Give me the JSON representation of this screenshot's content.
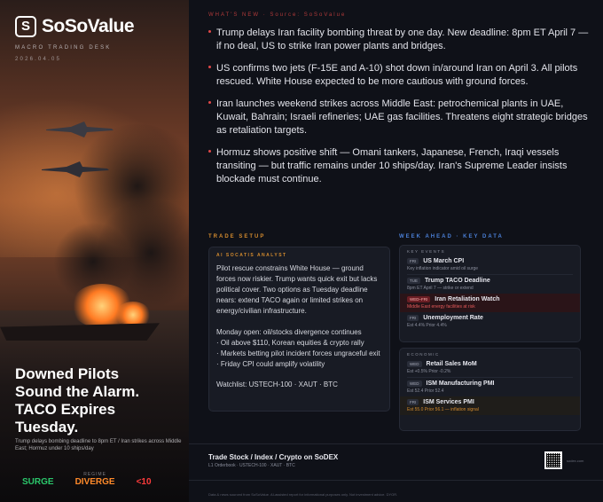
{
  "brand": {
    "name": "SoSoValue",
    "desk": "MACRO TRADING DESK",
    "date": "2026.04.05"
  },
  "hero": {
    "headline": [
      "Downed Pilots",
      "Sound the Alarm.",
      "TACO Expires",
      "Tuesday."
    ],
    "subhead": "Trump delays bombing deadline to 8pm ET / Iran strikes across Middle East; Hormuz under 10 ships/day",
    "tags": [
      {
        "label": "",
        "value": "SURGE",
        "color": "#2bc76b"
      },
      {
        "label": "REGIME",
        "value": "DIVERGE",
        "color": "#ff8a2a"
      },
      {
        "label": "",
        "value": "<10",
        "color": "#ff3b3b"
      }
    ]
  },
  "news": {
    "header": "WHAT'S NEW · Source: SoSoValue",
    "items": [
      "Trump delays Iran facility bombing threat by one day. New deadline: 8pm ET April 7 — if no deal, US to strike Iran power plants and bridges.",
      "US confirms two jets (F-15E and A-10) shot down in/around Iran on April 3. All pilots rescued. White House expected to be more cautious with ground forces.",
      "Iran launches weekend strikes across Middle East: petrochemical plants in UAE, Kuwait, Bahrain; Israeli refineries; UAE gas facilities. Threatens eight strategic bridges as retaliation targets.",
      "Hormuz shows positive shift — Omani tankers, Japanese, French, Iraqi vessels transiting — but traffic remains under 10 ships/day. Iran's Supreme Leader insists blockade must continue."
    ]
  },
  "trade": {
    "header": "TRADE SETUP",
    "card_label": "AI SOCATIS ANALYST",
    "para1": "Pilot rescue constrains White House — ground forces now riskier. Trump wants quick exit but lacks political cover. Two options as Tuesday deadline nears: extend TACO again or limited strikes on energy/civilian infrastructure.",
    "para2_title": "Monday open: oil/stocks divergence continues",
    "bullets": [
      "· Oil above $110, Korean equities & crypto rally",
      "· Markets betting pilot incident forces ungraceful exit",
      "· Friday CPI could amplify volatility"
    ],
    "watchlist": "Watchlist:  USTECH-100 · XAUT · BTC"
  },
  "week": {
    "header": "WEEK AHEAD · KEY DATA",
    "key_label": "KEY EVENTS",
    "key_events": [
      {
        "day": "FRI",
        "title": "US March CPI",
        "sub": "Key inflation indicator amid oil surge",
        "hi": false
      },
      {
        "day": "TUE",
        "title": "Trump TACO Deadline",
        "sub": "8pm ET April 7 — strike or extend",
        "hi": false
      },
      {
        "day": "WED–FRI",
        "title": "Iran Retaliation Watch",
        "sub": "Middle East energy facilities at risk",
        "hi": true
      },
      {
        "day": "FRI",
        "title": "Unemployment Rate",
        "sub": "Est 4.4%    Prior 4.4%",
        "hi": false
      }
    ],
    "eco_label": "ECONOMIC",
    "eco_events": [
      {
        "day": "WED",
        "title": "Retail Sales MoM",
        "sub": "Est +0.5%    Prior -0.2%",
        "hi": false
      },
      {
        "day": "WED",
        "title": "ISM Manufacturing PMI",
        "sub": "Est 52.4    Prior 52.4",
        "hi": false
      },
      {
        "day": "FRI",
        "title": "ISM Services PMI",
        "sub": "Est 55.0    Prior 56.1 — inflation signal",
        "hi": true
      }
    ]
  },
  "footer": {
    "title": "Trade Stock / Index / Crypto on SoDEX",
    "sub": "L1 Orderbook  ·  USTECH-100  ·  XAUT  ·  BTC",
    "qr_label": "sodex.com",
    "disclaimer": "Data & news sourced from SoSoValue. AI-assisted report for informational purposes only. Not investment advice. DYOR."
  }
}
